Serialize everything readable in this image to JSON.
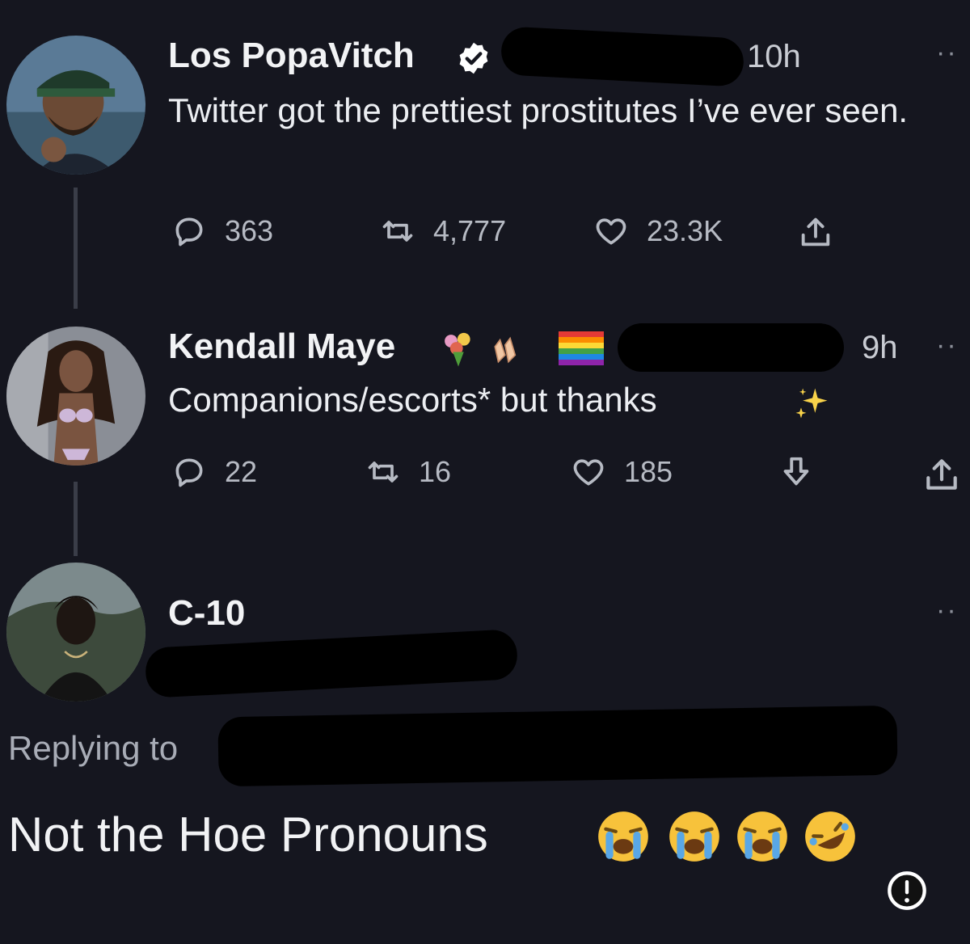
{
  "tweet1": {
    "author": "Los PopaVitch",
    "time": "10h",
    "text": "Twitter got the prettiest prostitutes I’ve ever seen.",
    "replies": "363",
    "retweets": "4,777",
    "likes": "23.3K",
    "more": "··"
  },
  "tweet2": {
    "author": "Kendall Maye",
    "time": "9h",
    "text": "Companions/escorts* but thanks",
    "replies": "22",
    "retweets": "16",
    "likes": "185",
    "more": "··"
  },
  "tweet3": {
    "author": "C-10",
    "replying_label": "Replying to",
    "text": "Not the Hoe Pronouns",
    "more": "··"
  },
  "colors": {
    "background": "#15161f",
    "verified": "#ffffff",
    "thread_line": "#3a3d48"
  },
  "icons": {
    "reply": "reply-icon",
    "retweet": "retweet-icon",
    "like": "heart-icon",
    "share": "share-icon",
    "download": "download-icon",
    "info": "info-icon"
  }
}
